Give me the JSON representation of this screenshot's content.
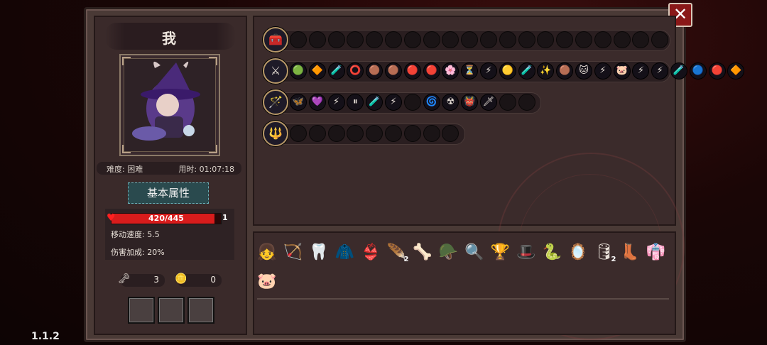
{
  "version": "1.1.2",
  "close_label": "✕",
  "player": {
    "name": "我",
    "difficulty": "难度: 困难",
    "time": "用时: 01:07:18",
    "attr_button": "基本属性",
    "hp_text": "420/445",
    "hp_fraction": 0.944,
    "shield": "1",
    "move_speed": "移动速度: 5.5",
    "damage_bonus": "伤害加成: 20%",
    "keys": "3",
    "coins": "0"
  },
  "rows": [
    {
      "weapon_icon": "chest-icon",
      "glyph": "🧰",
      "filled": [],
      "empty": 20
    },
    {
      "weapon_icon": "mace-icon",
      "glyph": "⚔",
      "filled": [
        "🟢",
        "🔶",
        "🧪",
        "⭕",
        "🟤",
        "🟤",
        "🔴",
        "🔴",
        "🌸",
        "⏳",
        "⚡",
        "🟡",
        "🧪",
        "✨",
        "🟤",
        "🐱",
        "⚡",
        "🐷",
        "⚡",
        "⚡",
        "🧪",
        "🔵",
        "🔴",
        "🔶"
      ],
      "empty": 0
    },
    {
      "weapon_icon": "staff-icon",
      "glyph": "🪄",
      "filled": [
        "🦋",
        "💜",
        "⚡",
        "⏸",
        "🧪",
        "⚡"
      ],
      "mid_empty": 1,
      "filled2": [
        "🌀",
        "☢",
        "👹",
        "🗡"
      ],
      "empty": 2
    },
    {
      "weapon_icon": "sceptre-icon",
      "glyph": "🔱",
      "filled": [],
      "empty": 9
    }
  ],
  "items": [
    {
      "name": "portrait-item",
      "glyph": "👧"
    },
    {
      "name": "arrow-item",
      "glyph": "🏹"
    },
    {
      "name": "teeth-item",
      "glyph": "🦷"
    },
    {
      "name": "cloak-item",
      "glyph": "🧥"
    },
    {
      "name": "bra-item",
      "glyph": "👙"
    },
    {
      "name": "feather-item",
      "glyph": "🪶",
      "count": "2"
    },
    {
      "name": "bone-item",
      "glyph": "🦴"
    },
    {
      "name": "helmet-item",
      "glyph": "🪖"
    },
    {
      "name": "magnifier-item",
      "glyph": "🔍"
    },
    {
      "name": "trophy-item",
      "glyph": "🏆"
    },
    {
      "name": "hat-item",
      "glyph": "🎩"
    },
    {
      "name": "snake-item",
      "glyph": "🐍"
    },
    {
      "name": "mirror-item",
      "glyph": "🪞"
    },
    {
      "name": "barrel-item",
      "glyph": "🛢",
      "count": "2"
    },
    {
      "name": "boot-item",
      "glyph": "👢"
    },
    {
      "name": "robe-item",
      "glyph": "👘"
    },
    {
      "name": "pig-item",
      "glyph": "🐷"
    }
  ]
}
